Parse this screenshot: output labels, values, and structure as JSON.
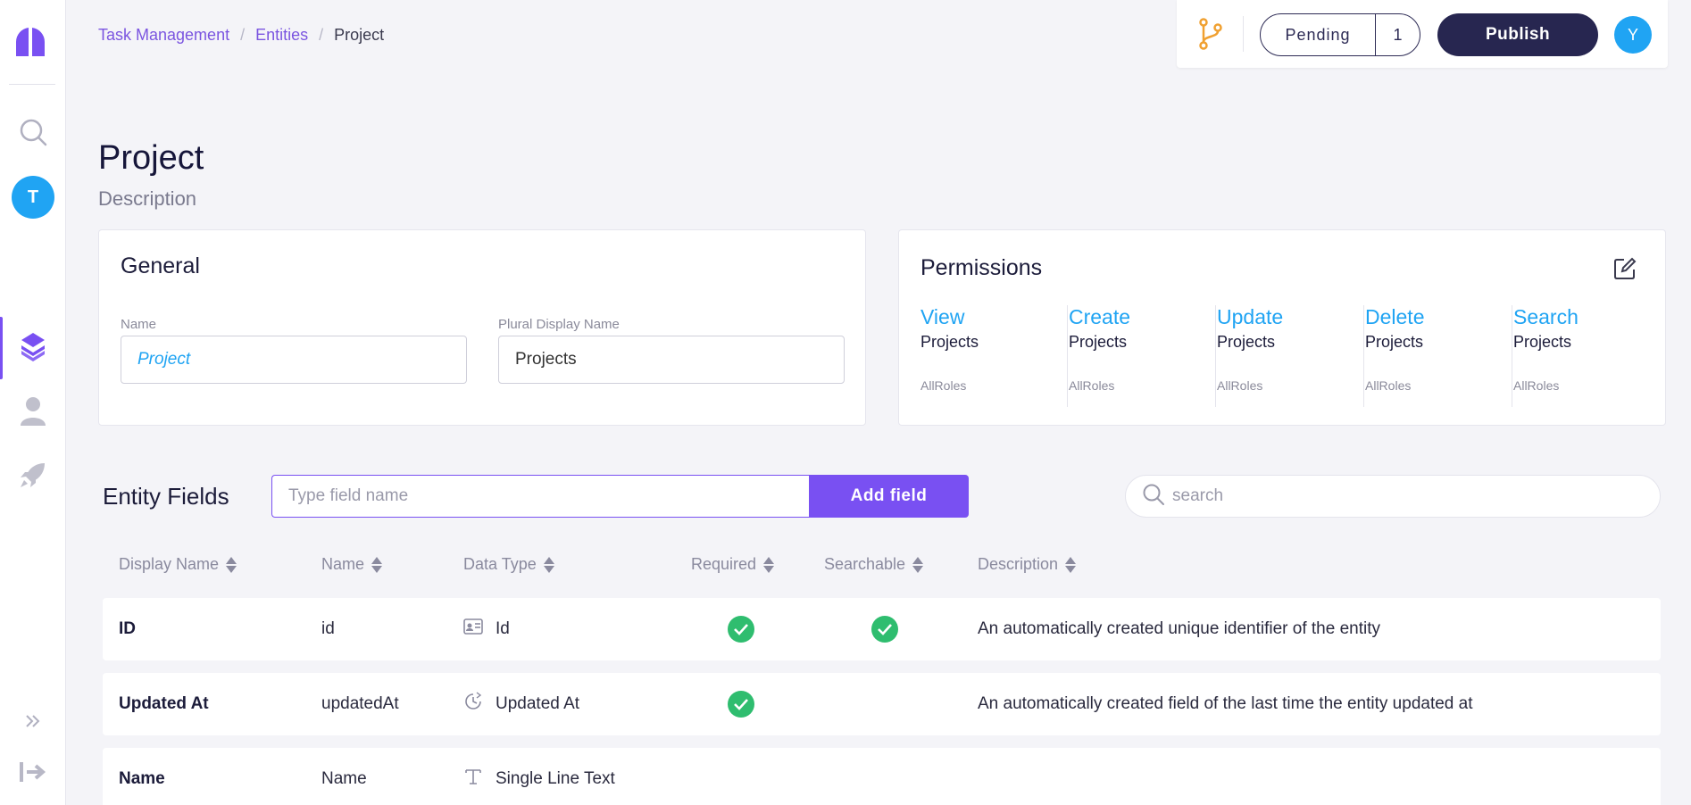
{
  "breadcrumb": {
    "items": [
      "Task Management",
      "Entities",
      "Project"
    ],
    "separator": "/"
  },
  "topbar": {
    "pending_label": "Pending",
    "pending_count": "1",
    "publish_label": "Publish",
    "user_initial": "Y"
  },
  "sidebar": {
    "workspace_initial": "T"
  },
  "page": {
    "title": "Project",
    "description": "Description"
  },
  "general": {
    "title": "General",
    "name_label": "Name",
    "name_value": "Project",
    "plural_label": "Plural Display Name",
    "plural_value": "Projects"
  },
  "permissions": {
    "title": "Permissions",
    "columns": [
      {
        "action": "View",
        "entity": "Projects",
        "roles": "AllRoles"
      },
      {
        "action": "Create",
        "entity": "Projects",
        "roles": "AllRoles"
      },
      {
        "action": "Update",
        "entity": "Projects",
        "roles": "AllRoles"
      },
      {
        "action": "Delete",
        "entity": "Projects",
        "roles": "AllRoles"
      },
      {
        "action": "Search",
        "entity": "Projects",
        "roles": "AllRoles"
      }
    ]
  },
  "entity_fields": {
    "title": "Entity Fields",
    "input_placeholder": "Type field name",
    "add_button": "Add field",
    "search_placeholder": "search",
    "headers": [
      "Display Name",
      "Name",
      "Data Type",
      "Required",
      "Searchable",
      "Description"
    ],
    "rows": [
      {
        "display_name": "ID",
        "name": "id",
        "data_type": "Id",
        "type_icon": "id-card-icon",
        "required": true,
        "searchable": true,
        "description": "An automatically created unique identifier of the entity"
      },
      {
        "display_name": "Updated At",
        "name": "updatedAt",
        "data_type": "Updated At",
        "type_icon": "clock-icon",
        "required": true,
        "searchable": false,
        "description": "An automatically created field of the last time the entity updated at"
      },
      {
        "display_name": "Name",
        "name": "Name",
        "data_type": "Single Line Text",
        "type_icon": "text-t-icon",
        "required": false,
        "searchable": false,
        "description": ""
      }
    ]
  },
  "colors": {
    "accent": "#7950f2",
    "link": "#20a4f3",
    "dark": "#272650",
    "success": "#2fbd6f",
    "branch": "#f0a030"
  }
}
